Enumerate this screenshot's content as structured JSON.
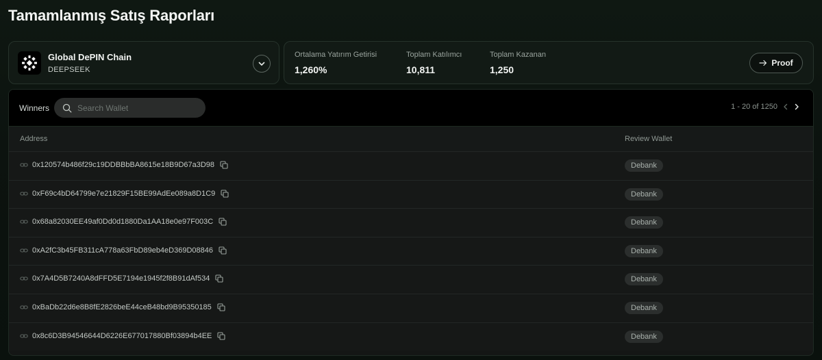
{
  "page_title": "Tamamlanmış Satış Raporları",
  "chain": {
    "name": "Global DePIN Chain",
    "subtitle": "DEEPSEEK"
  },
  "stats": [
    {
      "label": "Ortalama Yatırım Getirisi",
      "value": "1,260%"
    },
    {
      "label": "Toplam Katılımcı",
      "value": "10,811"
    },
    {
      "label": "Toplam Kazanan",
      "value": "1,250"
    }
  ],
  "proof_label": "Proof",
  "winners": {
    "label": "Winners",
    "search_placeholder": "Search Wallet",
    "pagination": "1 - 20 of 1250",
    "columns": {
      "address": "Address",
      "review": "Review Wallet"
    },
    "rows": [
      {
        "address": "0x120574b486f29c19DDBBbBA8615e18B9D67a3D98",
        "review": "Debank"
      },
      {
        "address": "0xF69c4bD64799e7e21829F15BE99AdEe089a8D1C9",
        "review": "Debank"
      },
      {
        "address": "0x68a82030EE49af0Dd0d1880Da1AA18e0e97F003C",
        "review": "Debank"
      },
      {
        "address": "0xA2fC3b45FB311cA778a63FbD89eb4eD369D08846",
        "review": "Debank"
      },
      {
        "address": "0x7A4D5B7240A8dFFD5E7194e1945f2f8B91dAf534",
        "review": "Debank"
      },
      {
        "address": "0xBaDb22d6e8B8fE2826beE44ceB48bd9B95350185",
        "review": "Debank"
      },
      {
        "address": "0x8c6D3B94546644D6226E677017880Bf03894b4EE",
        "review": "Debank"
      }
    ]
  },
  "colors": {
    "background": "#0c130f",
    "card": "#121a15",
    "badge": "#2b2e2d"
  }
}
